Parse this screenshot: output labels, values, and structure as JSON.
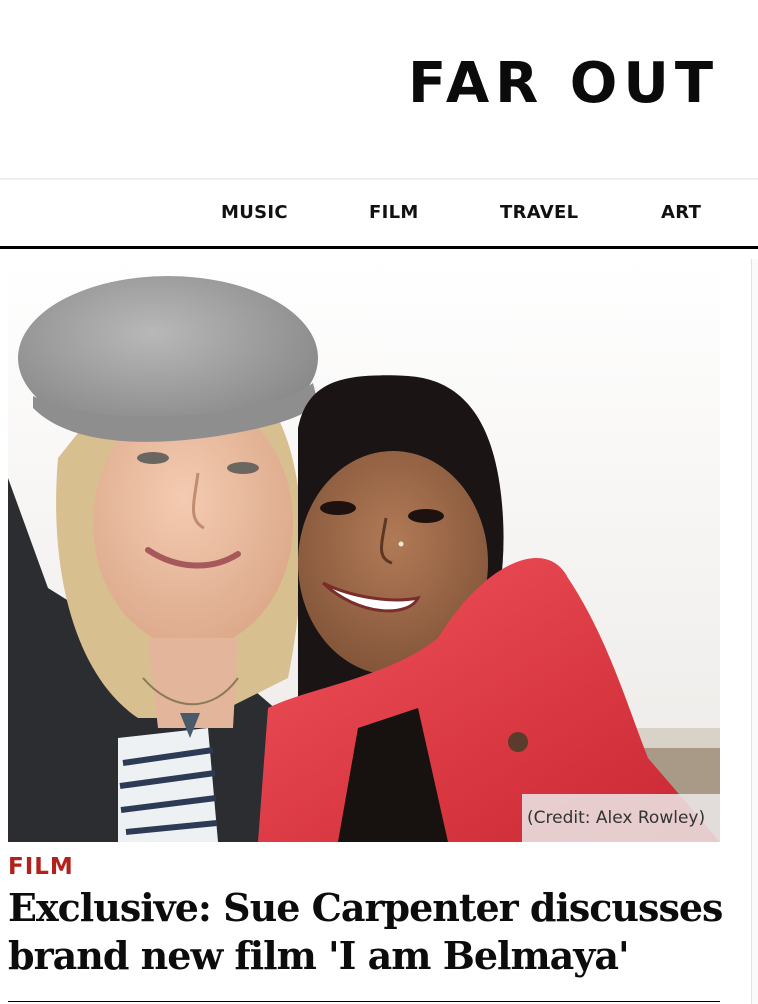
{
  "site": {
    "logo": "FAR OUT"
  },
  "nav": {
    "items": [
      {
        "label": "MUSIC"
      },
      {
        "label": "FILM"
      },
      {
        "label": "TRAVEL"
      },
      {
        "label": "ART"
      }
    ]
  },
  "article": {
    "image_alt": "Photo of two women smiling together outdoors",
    "image_credit": "(Credit: Alex Rowley)",
    "category": "FILM",
    "headline": "Exclusive: Sue Carpenter discusses brand new film 'I am Belmaya'"
  },
  "colors": {
    "category_red": "#b3211c",
    "jacket_red": "#e63a44",
    "beret_grey": "#9c9c9c"
  }
}
